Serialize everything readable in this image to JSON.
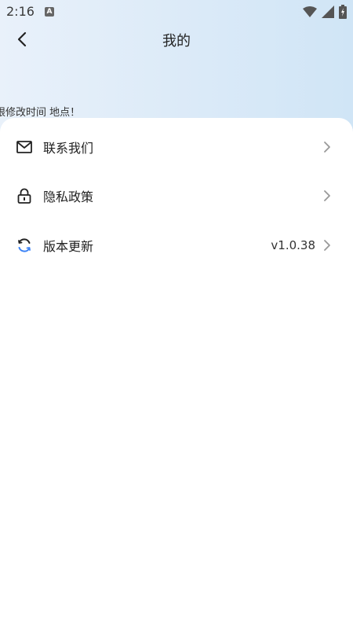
{
  "status_bar": {
    "time": "2:16",
    "app_icon_letter": "A",
    "icons": [
      "wifi-icon",
      "signal-icon",
      "battery-icon"
    ]
  },
  "navbar": {
    "title": "我的",
    "back_icon": "chevron-left-icon"
  },
  "notice": {
    "text": "限修改时间 地点！"
  },
  "menu": {
    "items": [
      {
        "label": "联系我们",
        "icon": "mail-icon",
        "value": ""
      },
      {
        "label": "隐私政策",
        "icon": "lock-icon",
        "value": ""
      },
      {
        "label": "版本更新",
        "icon": "refresh-icon",
        "value": "v1.0.38"
      }
    ]
  },
  "colors": {
    "header_gradient_start": "#e9f1fa",
    "header_gradient_end": "#d0e5f6",
    "refresh_accent": "#3b82f6",
    "text": "#222222",
    "chevron": "#999999"
  }
}
